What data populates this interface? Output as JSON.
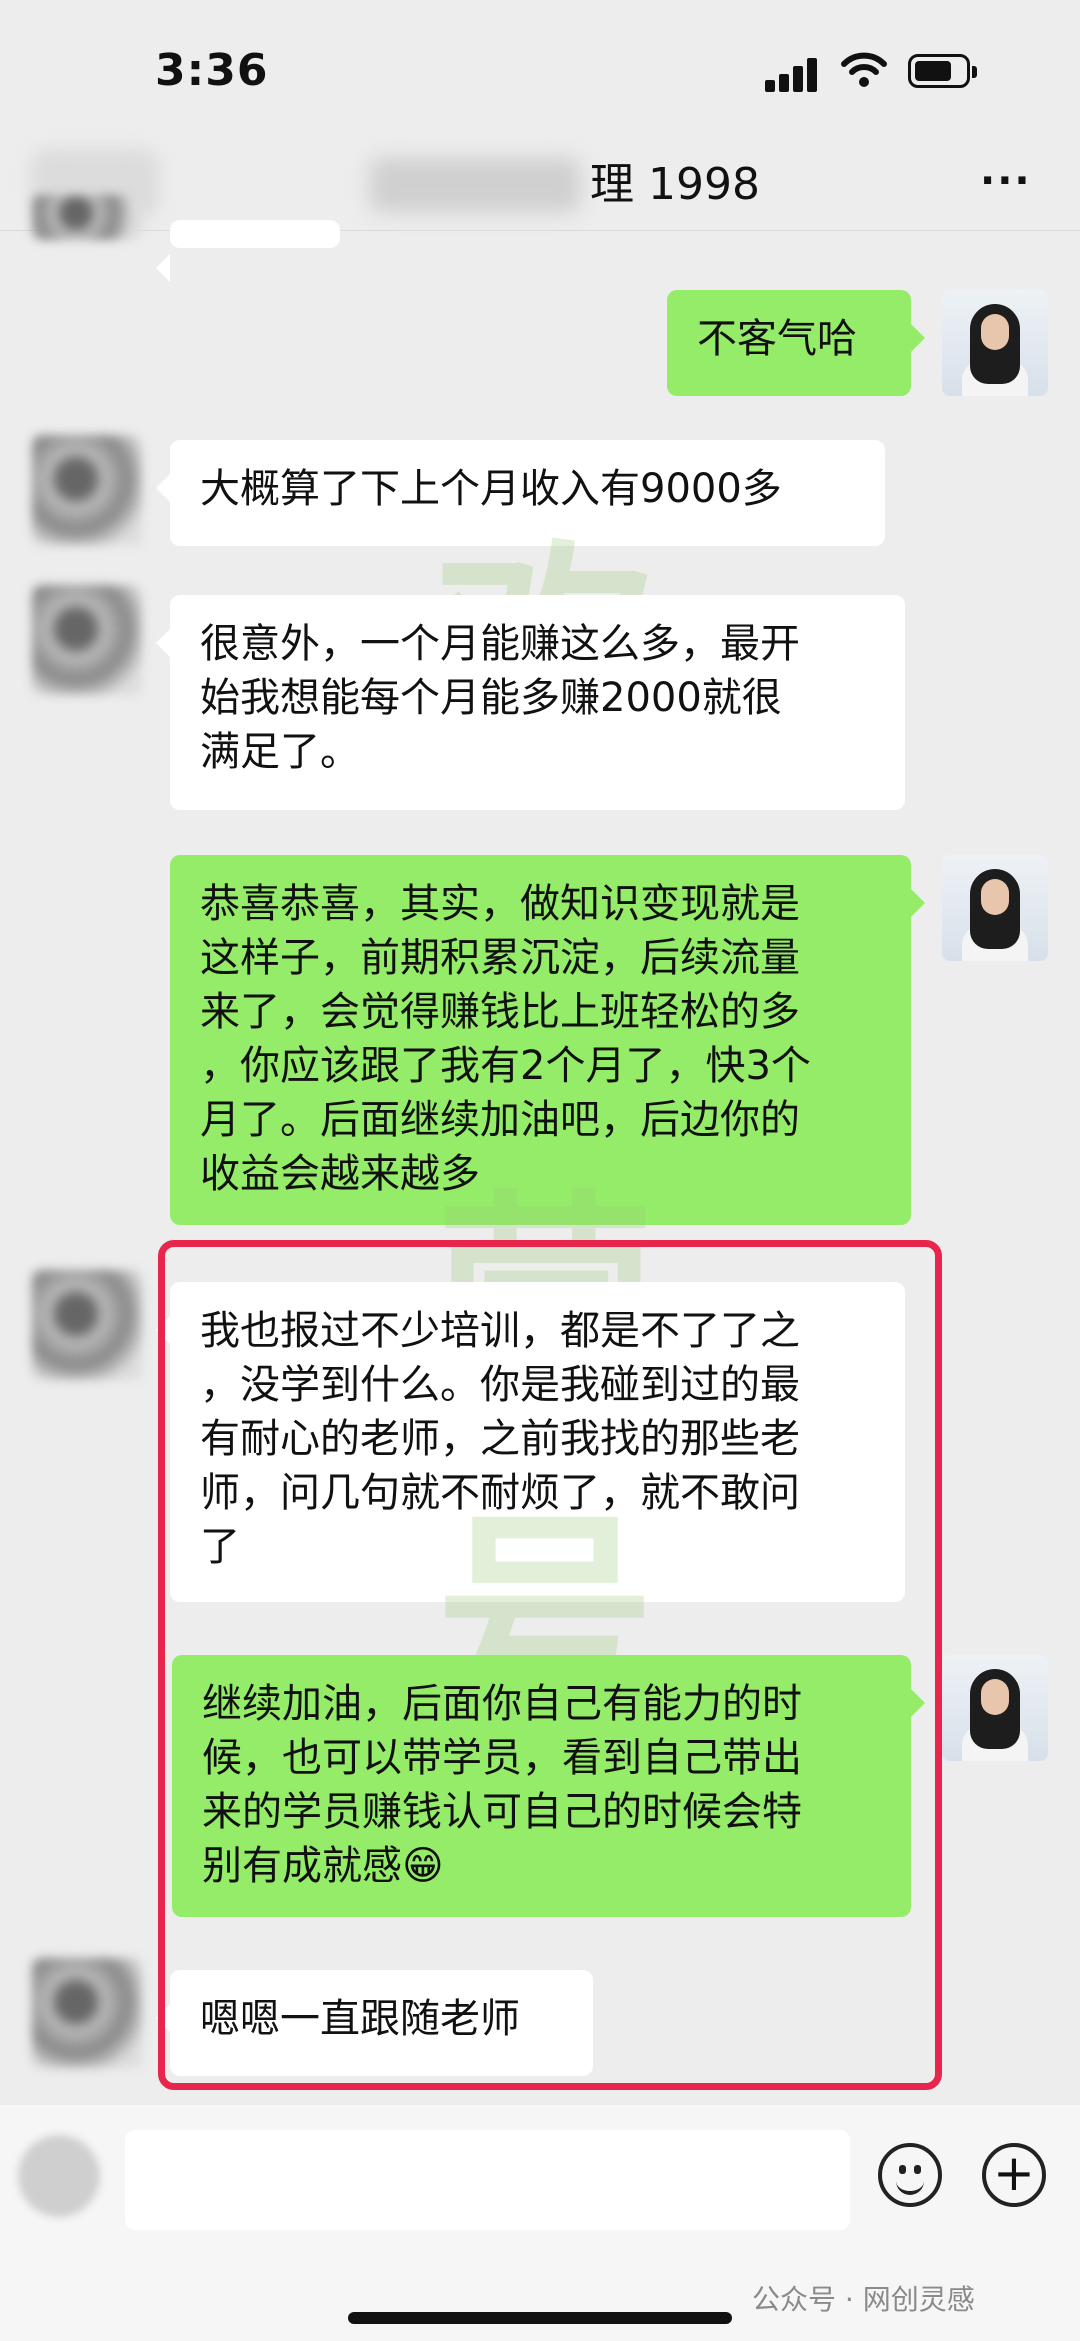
{
  "status": {
    "time": "3:36"
  },
  "header": {
    "title_visible": "理 1998",
    "more_label": "···"
  },
  "messages": {
    "m1": "不客气哈",
    "m2": "大概算了下上个月收入有9000多",
    "m3": "很意外，一个月能赚这么多，最开\n始我想能每个月能多赚2000就很\n满足了。",
    "m4": "恭喜恭喜，其实，做知识变现就是\n这样子，前期积累沉淀，后续流量\n来了，会觉得赚钱比上班轻松的多\n，你应该跟了我有2个月了，快3个\n月了。后面继续加油吧，后边你的\n收益会越来越多",
    "m5": "我也报过不少培训，都是不了了之\n，没学到什么。你是我碰到过的最\n有耐心的老师，之前我找的那些老\n师，问几句就不耐烦了，就不敢问\n了",
    "m6": "继续加油，后面你自己有能力的时\n候，也可以带学员，看到自己带出\n来的学员赚钱认可自己的时候会特\n别有成就感😁",
    "m7": "嗯嗯一直跟随老师"
  },
  "watermarks": {
    "w1": "欢",
    "w2": "营",
    "w3": "号"
  },
  "footer": {
    "source_watermark": "公众号 · 网创灵感",
    "plus": "+"
  },
  "colors": {
    "outgoing_bubble": "#95ec69",
    "incoming_bubble": "#ffffff",
    "highlight_border": "#e8264d",
    "background": "#ededed"
  }
}
